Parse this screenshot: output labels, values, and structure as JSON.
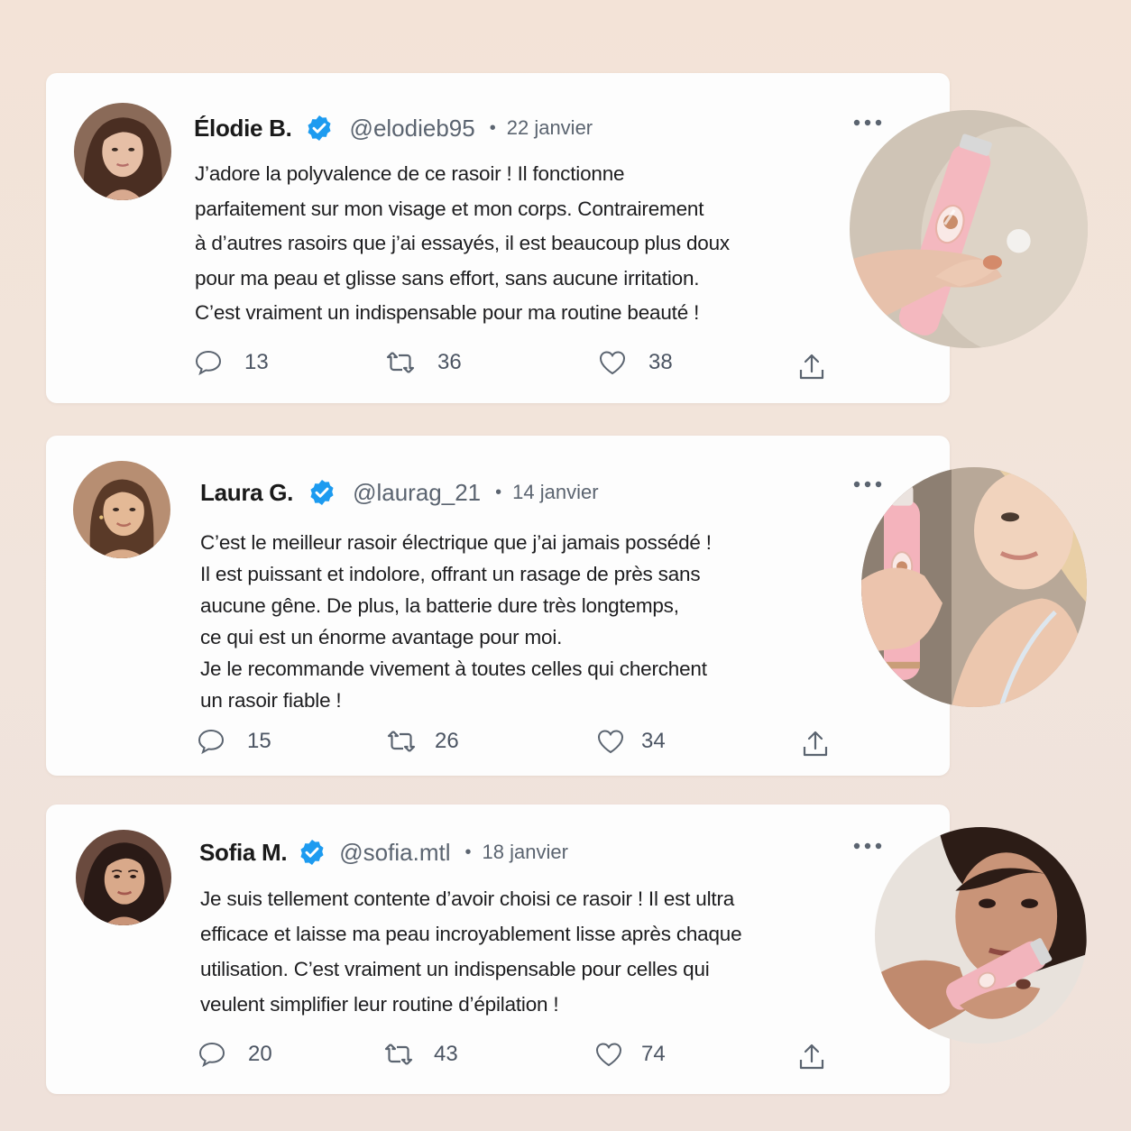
{
  "tweets": [
    {
      "name": "Élodie B.",
      "handle": "@elodieb95",
      "separator": "•",
      "date": "22 janvier",
      "lines": [
        "J’adore la polyvalence de ce rasoir ! Il fonctionne",
        "parfaitement sur mon visage et mon corps. Contrairement",
        "à d’autres rasoirs que j’ai essayés, il est beaucoup plus doux",
        "pour ma peau et glisse sans effort, sans aucune irritation.",
        "C’est vraiment un indispensable pour ma routine beauté !"
      ],
      "replies": "13",
      "retweets": "36",
      "likes": "38"
    },
    {
      "name": "Laura G.",
      "handle": "@laurag_21",
      "separator": "•",
      "date": "14 janvier",
      "lines": [
        "C’est le meilleur rasoir électrique que j’ai jamais possédé !",
        "Il est puissant et indolore, offrant un rasage de près sans",
        "aucune gêne. De plus, la batterie dure très longtemps,",
        "ce qui est un énorme avantage pour moi.",
        "Je le recommande vivement à toutes celles qui cherchent",
        "un rasoir fiable !"
      ],
      "replies": "15",
      "retweets": "26",
      "likes": "34"
    },
    {
      "name": "Sofia M.",
      "handle": "@sofia.mtl",
      "separator": "•",
      "date": "18 janvier",
      "lines": [
        "Je suis tellement contente d’avoir choisi ce rasoir ! Il est ultra",
        "efficace et laisse ma peau incroyablement lisse après chaque",
        "utilisation. C’est vraiment un indispensable pour celles qui",
        "veulent simplifier leur routine d’épilation !"
      ],
      "replies": "20",
      "retweets": "43",
      "likes": "74"
    }
  ],
  "colors": {
    "verified": "#1d9bf0",
    "icon": "#5b6470",
    "product_pink": "#f4b8bf"
  },
  "icons": {
    "reply": "speech-bubble-icon",
    "retweet": "retweet-arrows-icon",
    "like": "heart-outline-icon",
    "share": "share-upload-icon",
    "more": "horizontal-ellipsis-icon",
    "verified": "verified-badge-icon"
  }
}
